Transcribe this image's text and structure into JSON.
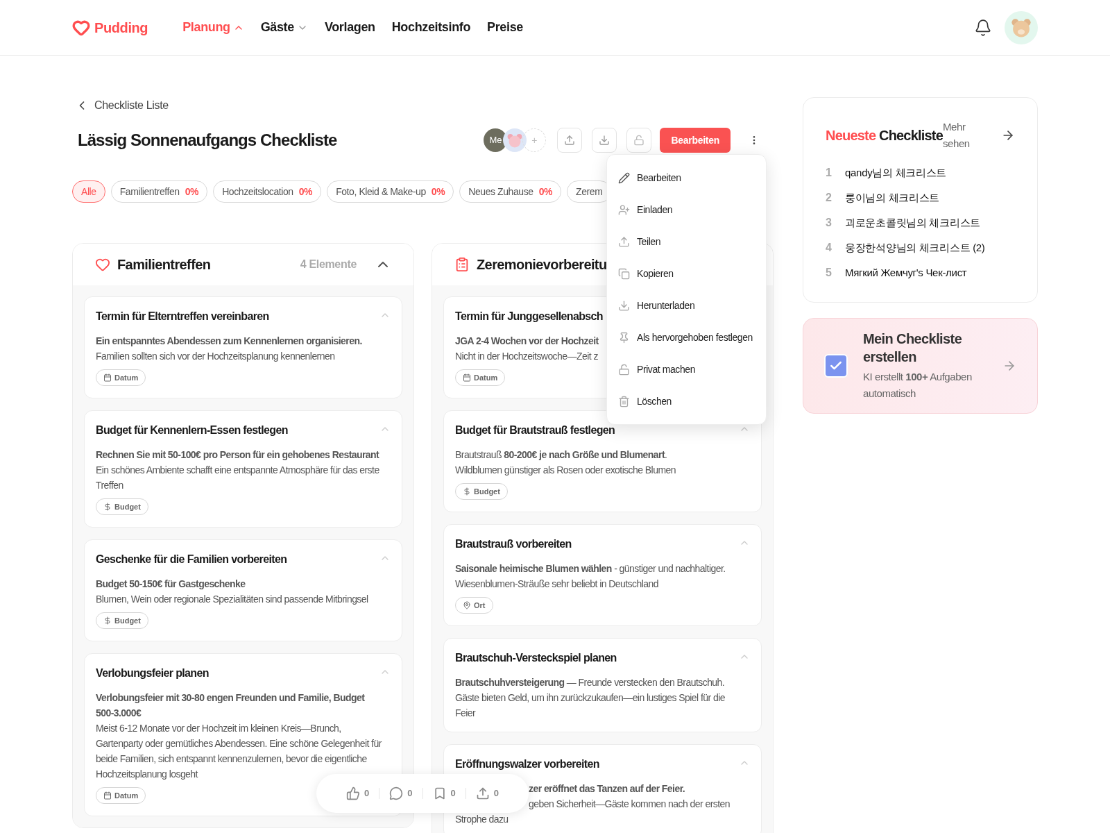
{
  "header": {
    "logo": "Pudding",
    "nav": [
      {
        "label": "Planung",
        "kind": "menu",
        "selected": true,
        "expanded": true
      },
      {
        "label": "Gäste",
        "kind": "menu",
        "selected": false,
        "expanded": false
      },
      {
        "label": "Vorlagen",
        "kind": "link",
        "selected": false
      },
      {
        "label": "Hochzeitsinfo",
        "kind": "link",
        "selected": false
      },
      {
        "label": "Preise",
        "kind": "link",
        "selected": false
      }
    ]
  },
  "back_link": "Checkliste Liste",
  "title": "Lässig Sonnenaufgangs Checkliste",
  "members": [
    {
      "kind": "initials",
      "label": "Me"
    },
    {
      "kind": "avatar"
    },
    {
      "kind": "add",
      "label": "+"
    }
  ],
  "actions": {
    "primary": "Bearbeiten"
  },
  "menu": [
    {
      "label": "Bearbeiten"
    },
    {
      "label": "Einladen"
    },
    {
      "label": "Teilen"
    },
    {
      "label": "Kopieren"
    },
    {
      "label": "Herunterladen"
    },
    {
      "label": "Als hervorgehoben festlegen"
    },
    {
      "label": "Privat machen"
    },
    {
      "label": "Löschen"
    }
  ],
  "filters": [
    {
      "label": "Alle",
      "selected": true
    },
    {
      "label": "Familientreffen",
      "percent": "0%",
      "selected": false
    },
    {
      "label": "Hochzeitslocation",
      "percent": "0%",
      "selected": false
    },
    {
      "label": "Foto, Kleid & Make-up",
      "percent": "0%",
      "selected": false
    },
    {
      "label": "Neues Zuhause",
      "percent": "0%",
      "selected": false
    },
    {
      "label": "Zerem",
      "selected": false
    }
  ],
  "columns": [
    {
      "title": "Familientreffen",
      "count": "4 Elemente",
      "expanded": true,
      "tasks": [
        {
          "title": "Termin für Elterntreffen vereinbaren",
          "expanded": true,
          "paragraphs": [
            {
              "text": "Ein entspanntes Abendessen zum Kennenlernen organisieren.",
              "strong": true
            },
            {
              "text": "Familien sollten sich vor der Hochzeitsplanung kennenlernen",
              "strong": false
            }
          ],
          "tag": {
            "kind": "date",
            "label": "Datum"
          }
        },
        {
          "title": "Budget für Kennenlern-Essen festlegen",
          "expanded": true,
          "paragraphs": [
            {
              "text": "Rechnen Sie mit 50-100€ pro Person für ein gehobenes Restaurant",
              "strong": true
            },
            {
              "text": "Ein schönes Ambiente schafft eine entspannte Atmosphäre für das erste Treffen",
              "strong": false
            }
          ],
          "tag": {
            "kind": "budget",
            "label": "Budget"
          }
        },
        {
          "title": "Geschenke für die Familien vorbereiten",
          "expanded": true,
          "paragraphs": [
            {
              "text": "Budget 50-150€ für Gastgeschenke",
              "strong": true
            },
            {
              "text": "Blumen, Wein oder regionale Spezialitäten sind passende Mitbringsel",
              "strong": false
            }
          ],
          "tag": {
            "kind": "budget",
            "label": "Budget"
          }
        },
        {
          "title": "Verlobungsfeier planen",
          "expanded": true,
          "paragraphs": [
            {
              "text": "Verlobungsfeier mit 30-80 engen Freunden und Familie, Budget 500-3.000€",
              "strong": true
            },
            {
              "text": "Meist 6-12 Monate vor der Hochzeit im kleinen Kreis—Brunch, Gartenparty oder gemütliches Abendessen. Eine schöne Gelegenheit für beide Familien, sich entspannt kennenzulernen, bevor die eigentliche Hochzeitsplanung losgeht",
              "strong": false
            }
          ],
          "tag": {
            "kind": "date",
            "label": "Datum"
          }
        }
      ]
    },
    {
      "title": "Zeremonievorbereitu",
      "tasks": [
        {
          "title": "Termin für Junggesellenabsch",
          "paragraphs": [
            {
              "text": "JGA 2-4 Wochen vor der Hochzeit",
              "strong": true
            },
            {
              "text": "Nicht in der Hochzeitswoche—Zeit z",
              "strong": false
            }
          ],
          "tag": {
            "kind": "date",
            "label": "Datum"
          }
        },
        {
          "title": "Budget für Brautstrauß festlegen",
          "expanded": true,
          "paragraphs": [
            {
              "text": "Brautstrauß **80-200€ je nach Größe und Blumenart**.",
              "strong": false
            },
            {
              "text": "Wildblumen günstiger als Rosen oder exotische Blumen",
              "strong": false
            }
          ],
          "tag": {
            "kind": "budget",
            "label": "Budget"
          }
        },
        {
          "title": "Brautstrauß vorbereiten",
          "expanded": true,
          "paragraphs": [
            {
              "text": "**Saisonale heimische Blumen wählen** - günstiger und nachhaltiger.",
              "strong": false
            },
            {
              "text": "Wiesenblumen-Sträuße sehr beliebt in Deutschland",
              "strong": false
            }
          ],
          "tag": {
            "kind": "place",
            "label": "Ort"
          }
        },
        {
          "title": "Brautschuh-Versteckspiel planen",
          "expanded": true,
          "paragraphs": [
            {
              "text": "**Brautschuhversteigerung** — Freunde verstecken den Brautschuh.",
              "strong": false
            },
            {
              "text": "Gäste bieten Geld, um ihn zurückzukaufen—ein lustiges Spiel für die Feier",
              "strong": false
            }
          ]
        },
        {
          "title": "Eröffnungswalzer vorbereiten",
          "expanded": true,
          "paragraphs": [
            {
              "text": "zer eröffnet das Tanzen auf der Feier.",
              "strong": true,
              "partly_hidden": true
            },
            {
              "text": "geben Sicherheit—Gäste kommen nach der ersten",
              "strong": false,
              "partly_hidden": true
            },
            {
              "text": "Strophe dazu",
              "strong": false
            }
          ]
        }
      ]
    }
  ],
  "sidebar": {
    "latest": {
      "accent": "Neueste",
      "title": "Checkliste",
      "more": "Mehr sehen",
      "items": [
        {
          "number": "1",
          "label": "qandy님의 체크리스트"
        },
        {
          "number": "2",
          "label": "룽이님의 체크리스트"
        },
        {
          "number": "3",
          "label": "괴로운초콜릿님의 체크리스트"
        },
        {
          "number": "4",
          "label": "웅장한석양님의 체크리스트 (2)"
        },
        {
          "number": "5",
          "label": "Мягкий Жемчуг's Чек-лист"
        }
      ]
    },
    "promo": {
      "checked": true,
      "title": "Mein Checkliste erstellen",
      "text": "KI erstellt **100+** Aufgaben automatisch"
    }
  },
  "reactions": [
    {
      "kind": "like",
      "count": "0"
    },
    {
      "kind": "comment",
      "count": "0"
    },
    {
      "kind": "bookmark",
      "count": "0"
    },
    {
      "kind": "share",
      "count": "0"
    }
  ]
}
